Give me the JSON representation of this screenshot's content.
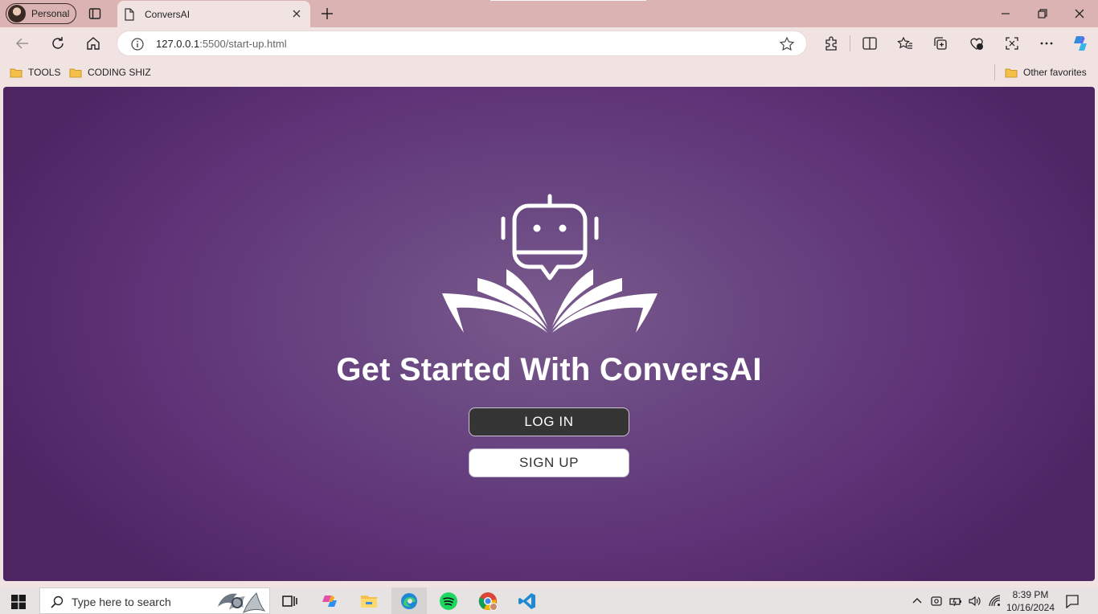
{
  "browser": {
    "profile_label": "Personal",
    "tab_title": "ConversAI",
    "url_host": "127.0.0.1",
    "url_rest": ":5500/start-up.html",
    "bookmarks": [
      "TOOLS",
      "CODING SHIZ"
    ],
    "other_favorites": "Other favorites"
  },
  "page": {
    "headline": "Get Started With ConversAI",
    "login_label": "LOG IN",
    "signup_label": "SIGN UP"
  },
  "taskbar": {
    "search_placeholder": "Type here to search",
    "time": "8:39 PM",
    "date": "10/16/2024"
  },
  "colors": {
    "tab_bar": "#dcb3b3",
    "chrome": "#f2e3e3",
    "page_purple": "#5f3478",
    "login_bg": "#353535",
    "signup_bg": "#ffffff"
  }
}
